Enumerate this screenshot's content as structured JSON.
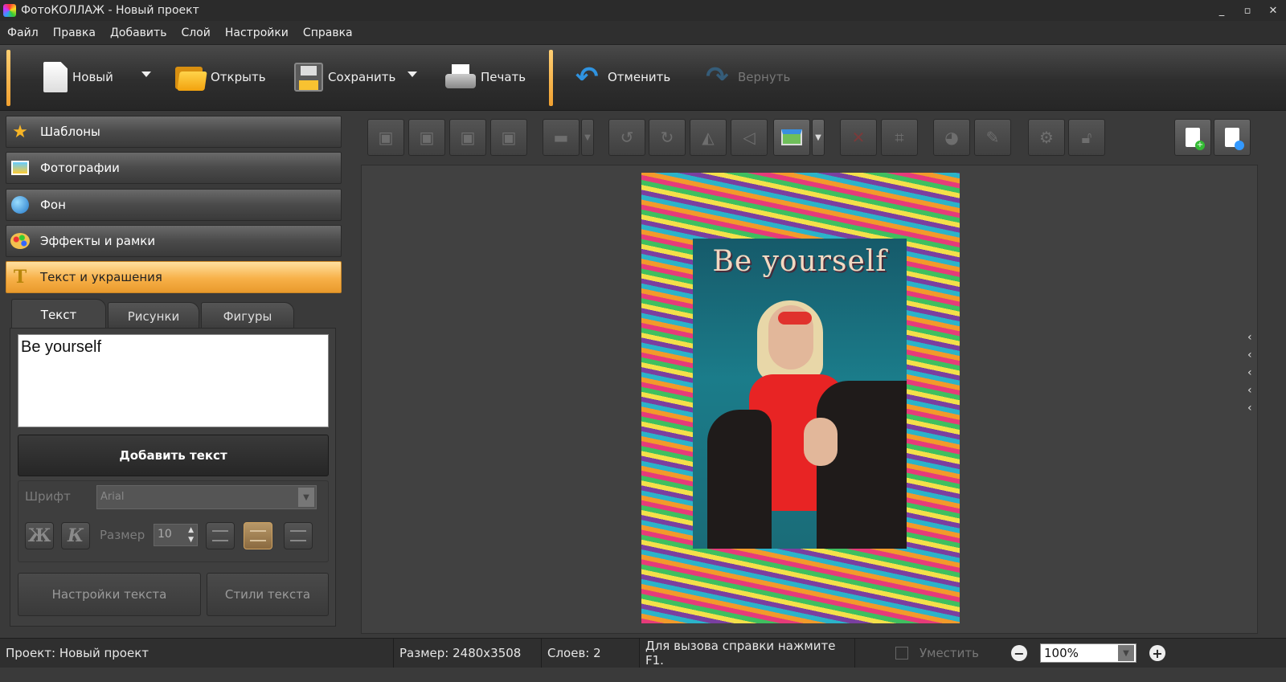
{
  "window": {
    "title": "ФотоКОЛЛАЖ - Новый проект",
    "controls": [
      "_",
      "▫",
      "✕"
    ]
  },
  "menu": [
    "Файл",
    "Правка",
    "Добавить",
    "Слой",
    "Настройки",
    "Справка"
  ],
  "toolbar": {
    "new": "Новый",
    "open": "Открыть",
    "save": "Сохранить",
    "print": "Печать",
    "undo": "Отменить",
    "redo": "Вернуть"
  },
  "sidebar": {
    "items": [
      {
        "label": "Шаблоны",
        "icon": "star-icon"
      },
      {
        "label": "Фотографии",
        "icon": "photo-icon"
      },
      {
        "label": "Фон",
        "icon": "globe-icon"
      },
      {
        "label": "Эффекты и рамки",
        "icon": "palette-icon"
      },
      {
        "label": "Текст и украшения",
        "icon": "text-t-icon",
        "active": true
      }
    ]
  },
  "tabs": [
    "Текст",
    "Рисунки",
    "Фигуры"
  ],
  "text_panel": {
    "text_value": "Be yourself",
    "add_text_label": "Добавить текст",
    "font_label": "Шрифт",
    "font_value": "Arial",
    "size_label": "Размер",
    "size_value": "10",
    "bold_glyph": "Ж",
    "italic_glyph": "К",
    "settings_label": "Настройки текста",
    "styles_label": "Стили текста"
  },
  "canvas": {
    "collage_text": "Be yourself",
    "accent_colors": {
      "accent": "#f7b048",
      "undo": "#2f93e0"
    }
  },
  "statusbar": {
    "project": "Проект:  Новый проект",
    "size": "Размер:  2480x3508",
    "layers": "Слоев:  2",
    "help": "Для вызова справки нажмите F1.",
    "fit": "Уместить",
    "zoom": "100%"
  }
}
